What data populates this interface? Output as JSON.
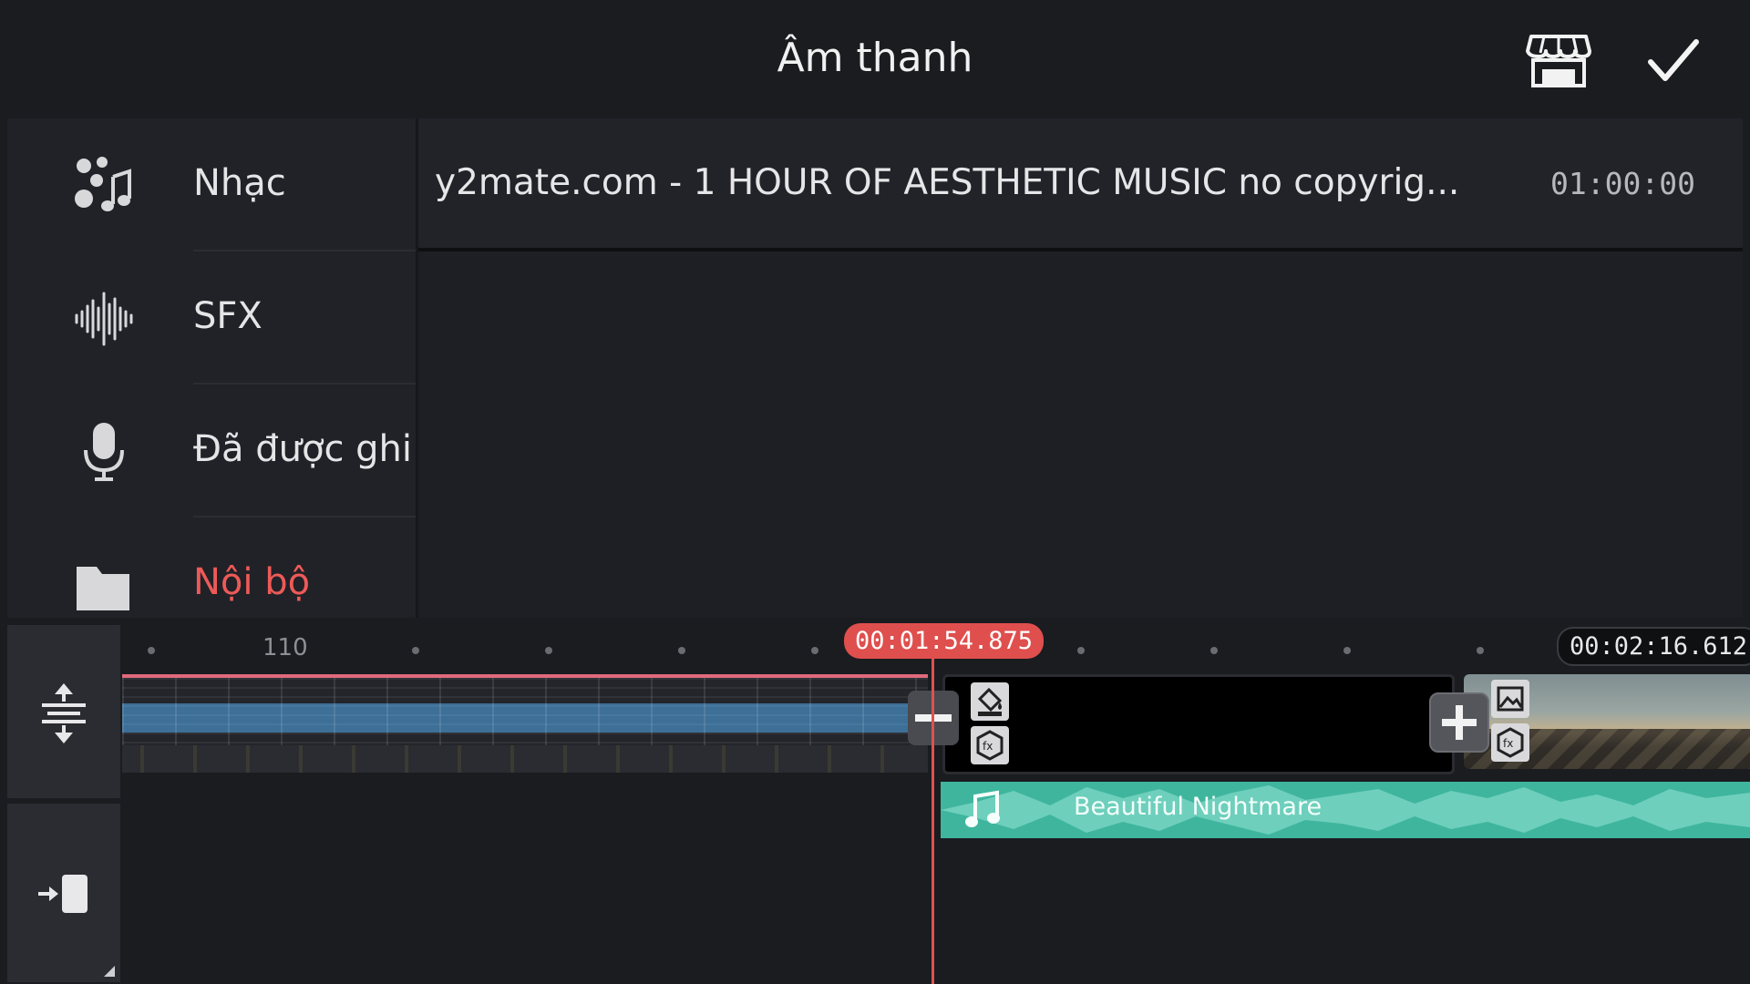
{
  "header": {
    "title": "Âm thanh",
    "store_icon": "store-icon",
    "confirm_icon": "checkmark-icon"
  },
  "categories": [
    {
      "label": "Nhạc",
      "icon": "music-notes-icon",
      "active": false
    },
    {
      "label": "SFX",
      "icon": "waveform-icon",
      "active": false
    },
    {
      "label": "Đã được ghi â",
      "icon": "microphone-icon",
      "active": false
    },
    {
      "label": "Nội bộ",
      "icon": "folder-icon",
      "active": true
    }
  ],
  "tracks": [
    {
      "name": "y2mate.com -  1 HOUR OF AESTHETIC MUSIC  no copyrig...",
      "duration": "01:00:00"
    }
  ],
  "timeline": {
    "ruler_label": "110",
    "playhead_time": "00:01:54.875",
    "end_time": "00:02:16.612",
    "audio_clip_label": "Beautiful Nightmare"
  },
  "colors": {
    "accent_red": "#e0514f",
    "audio_clip": "#3fb59e",
    "background": "#1b1c20"
  }
}
